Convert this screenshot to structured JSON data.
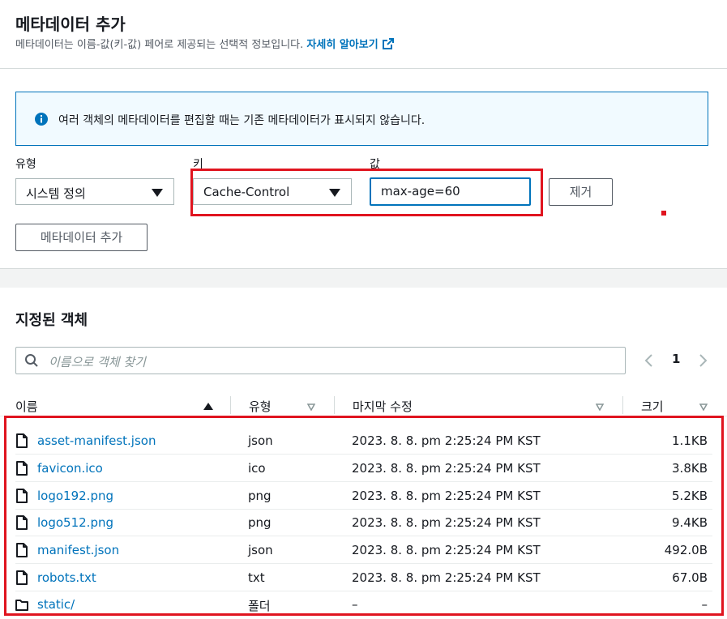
{
  "header": {
    "title": "메타데이터 추가",
    "description": "메타데이터는 이름-값(키-값) 페어로 제공되는 선택적 정보입니다.",
    "learn_more": "자세히 알아보기"
  },
  "info": {
    "message": "여러 객체의 메타데이터를 편집할 때는 기존 메타데이터가 표시되지 않습니다."
  },
  "metadata_row": {
    "type_label": "유형",
    "type_value": "시스템 정의",
    "key_label": "키",
    "key_value": "Cache-Control",
    "value_label": "값",
    "value_value": "max-age=60",
    "remove_label": "제거"
  },
  "add_metadata_label": "메타데이터 추가",
  "objects": {
    "title": "지정된 객체",
    "search_placeholder": "이름으로 객체 찾기",
    "page": "1",
    "columns": {
      "name": "이름",
      "type": "유형",
      "modified": "마지막 수정",
      "size": "크기"
    },
    "rows": [
      {
        "name": "asset-manifest.json",
        "type": "json",
        "modified": "2023. 8. 8. pm 2:25:24 PM KST",
        "size": "1.1KB",
        "icon": "file-icon"
      },
      {
        "name": "favicon.ico",
        "type": "ico",
        "modified": "2023. 8. 8. pm 2:25:24 PM KST",
        "size": "3.8KB",
        "icon": "file-icon"
      },
      {
        "name": "logo192.png",
        "type": "png",
        "modified": "2023. 8. 8. pm 2:25:24 PM KST",
        "size": "5.2KB",
        "icon": "file-icon"
      },
      {
        "name": "logo512.png",
        "type": "png",
        "modified": "2023. 8. 8. pm 2:25:24 PM KST",
        "size": "9.4KB",
        "icon": "file-icon"
      },
      {
        "name": "manifest.json",
        "type": "json",
        "modified": "2023. 8. 8. pm 2:25:24 PM KST",
        "size": "492.0B",
        "icon": "file-icon"
      },
      {
        "name": "robots.txt",
        "type": "txt",
        "modified": "2023. 8. 8. pm 2:25:24 PM KST",
        "size": "67.0B",
        "icon": "file-icon"
      },
      {
        "name": "static/",
        "type": "폴더",
        "modified": "–",
        "size": "–",
        "icon": "folder-icon"
      }
    ]
  },
  "colors": {
    "link": "#0073bb",
    "highlight": "#e0141f",
    "info_bg": "#f1faff"
  }
}
